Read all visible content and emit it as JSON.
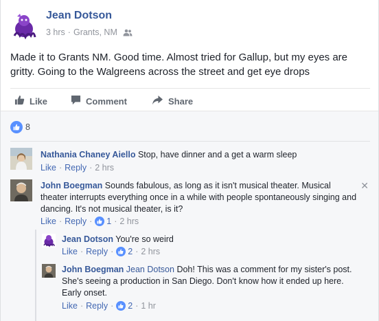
{
  "post": {
    "author": "Jean Dotson",
    "time": "3 hrs",
    "location": "Grants, NM",
    "text": "Made it to Grants NM. Good time. Almost tried for Gallup, but my eyes are gritty. Going to the Walgreens across the street and get eye drops"
  },
  "actions": {
    "like": "Like",
    "comment": "Comment",
    "share": "Share"
  },
  "reactions": {
    "count": "8"
  },
  "comments": [
    {
      "name": "Nathania Chaney Aiello",
      "text": "Stop, have dinner and a get a warm sleep",
      "like": "Like",
      "reply": "Reply",
      "time": "2 hrs"
    },
    {
      "name": "John Boegman",
      "text": "Sounds fabulous, as long as it isn't musical theater. Musical theater interrupts everything once in a while with people spontaneously singing and dancing. It's not musical theater, is it?",
      "like": "Like",
      "reply": "Reply",
      "likes": "1",
      "time": "2 hrs"
    }
  ],
  "replies": [
    {
      "name": "Jean Dotson",
      "text": "You're so weird",
      "like": "Like",
      "reply": "Reply",
      "likes": "2",
      "time": "2 hrs"
    },
    {
      "name": "John Boegman",
      "tag": "Jean Dotson",
      "text": "Doh! This was a comment for my sister's post. She's seeing a production in San Diego. Don't know how it ended up here. Early onset.",
      "like": "Like",
      "reply": "Reply",
      "likes": "2",
      "time": "1 hr"
    }
  ],
  "colors": {
    "link": "#365899",
    "like_blue": "#5890ff",
    "muted": "#90949c"
  }
}
